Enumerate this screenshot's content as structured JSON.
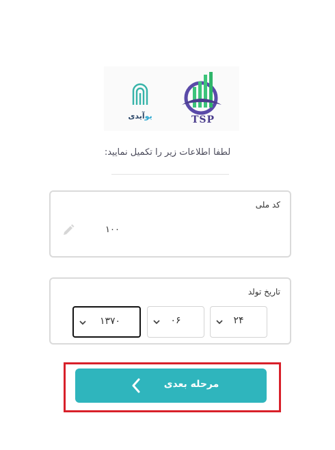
{
  "logos": {
    "uid_name_part1": "یو",
    "uid_name_part2": "آیدی",
    "tsp_name": "TSP"
  },
  "instruction": "لطفا اطلاعات زیر را تکمیل نمایید:",
  "national_id": {
    "label": "کد ملی",
    "value": "۱۰۰"
  },
  "birth_date": {
    "label": "تاریخ تولد",
    "year": "۱۳۷۰",
    "month": "۰۶",
    "day": "۲۴"
  },
  "next_button": {
    "label": "مرحله بعدی"
  },
  "colors": {
    "accent": "#2fb5bd",
    "highlight": "#d8202a"
  }
}
